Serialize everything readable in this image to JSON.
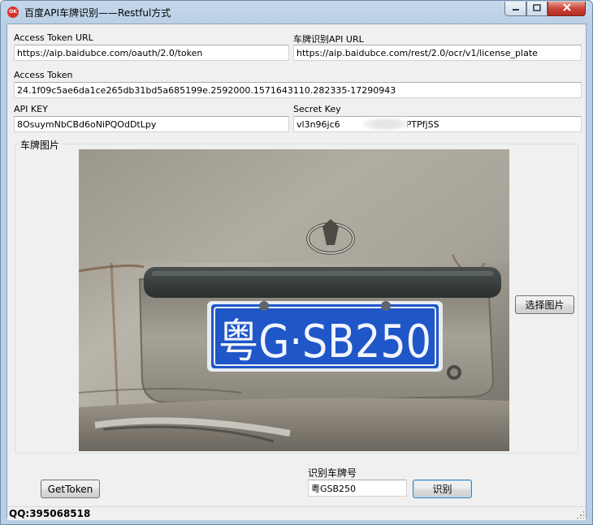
{
  "window": {
    "title": "百度API车牌识别——Restful方式",
    "icon_name": "app-icon",
    "icon_text": "OK",
    "controls": [
      "minimize-icon",
      "maximize-icon",
      "close-icon"
    ]
  },
  "fields": {
    "token_url": {
      "label": "Access Token URL",
      "value": "https://aip.baidubce.com/oauth/2.0/token"
    },
    "plate_api_url": {
      "label": "车牌识别API URL",
      "value": "https://aip.baidubce.com/rest/2.0/ocr/v1/license_plate"
    },
    "access_token": {
      "label": "Access  Token",
      "value": "24.1f09c5ae6da1ce265db31bd5a685199e.2592000.1571643110.282335-17290943"
    },
    "api_key": {
      "label": "API KEY",
      "value": "8OsuymNbCBd6oNiPQOdDtLpy"
    },
    "secret_key": {
      "label": "Secret Key",
      "value": "vl3n96jc6                ,bDLPTPfjSS"
    }
  },
  "image_group": {
    "title": "车牌图片",
    "plate_text": "粤G·SB250",
    "select_button": "选择图片"
  },
  "recognition": {
    "label": "识别车牌号",
    "result": "粤GSB250",
    "recognize_button": "识别",
    "get_token_button": "GetToken"
  },
  "status": {
    "text": "QQ:395068518"
  },
  "colors": {
    "plate_blue": "#1f56c8",
    "close_red": "#c9463a",
    "title_gradient": "#c4d8ec"
  }
}
